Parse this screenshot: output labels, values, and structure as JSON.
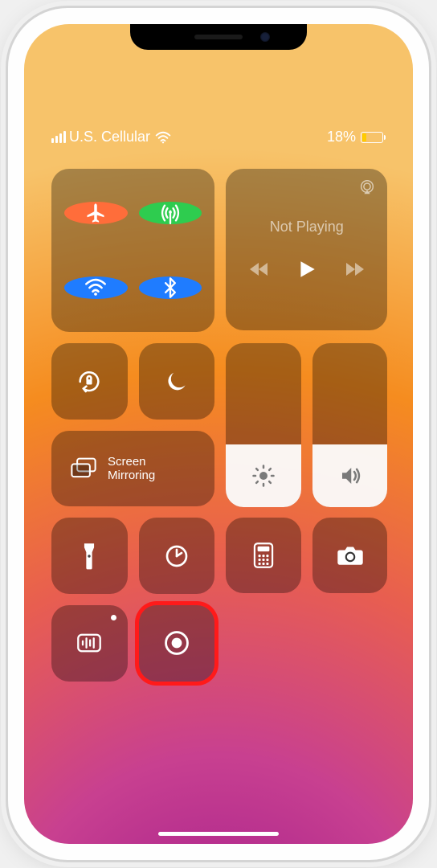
{
  "status": {
    "carrier": "U.S. Cellular",
    "battery_pct": "18%"
  },
  "media": {
    "title": "Not Playing"
  },
  "mirror": {
    "label_l1": "Screen",
    "label_l2": "Mirroring"
  },
  "sliders": {
    "brightness_pct": 38,
    "volume_pct": 38
  },
  "colors": {
    "highlight": "#ff1a1a",
    "low_battery": "#ffcc00"
  }
}
